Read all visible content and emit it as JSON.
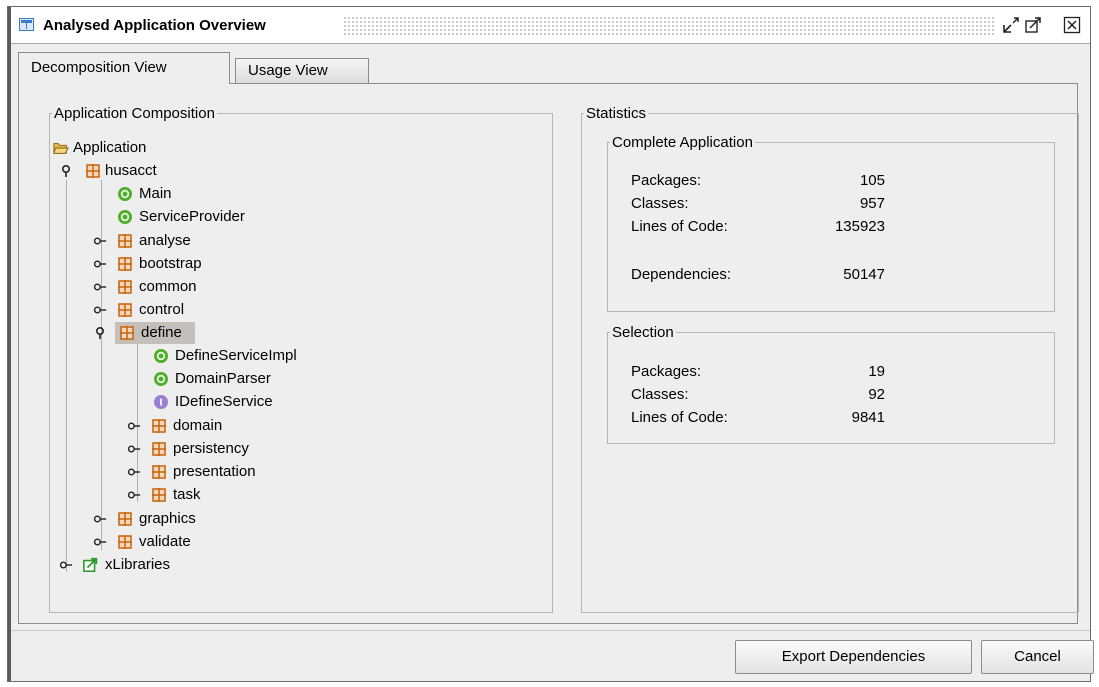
{
  "window": {
    "title": "Analysed Application Overview",
    "icons": [
      "window-icon",
      "minimize-icon",
      "maximize-icon",
      "close-icon"
    ]
  },
  "tabs": [
    {
      "label": "Decomposition View",
      "selected": true
    },
    {
      "label": "Usage View",
      "selected": false
    }
  ],
  "composition": {
    "legend": "Application Composition",
    "root": "Application",
    "nodes": {
      "husacct": "husacct",
      "main": "Main",
      "service_provider": "ServiceProvider",
      "analyse": "analyse",
      "bootstrap": "bootstrap",
      "common": "common",
      "control": "control",
      "define": "define",
      "define_service_impl": "DefineServiceImpl",
      "domain_parser": "DomainParser",
      "idefine_service": "IDefineService",
      "domain": "domain",
      "persistency": "persistency",
      "presentation": "presentation",
      "task": "task",
      "graphics": "graphics",
      "validate": "validate",
      "xlibraries": "xLibraries"
    },
    "selected_node": "define"
  },
  "statistics": {
    "legend": "Statistics",
    "complete": {
      "legend": "Complete Application",
      "packages_label": "Packages:",
      "packages": "105",
      "classes_label": "Classes:",
      "classes": "957",
      "loc_label": "Lines of Code:",
      "loc": "135923",
      "deps_label": "Dependencies:",
      "deps": "50147"
    },
    "selection": {
      "legend": "Selection",
      "packages_label": "Packages:",
      "packages": "19",
      "classes_label": "Classes:",
      "classes": "92",
      "loc_label": "Lines of Code:",
      "loc": "9841"
    }
  },
  "buttons": {
    "export": "Export Dependencies",
    "cancel": "Cancel"
  },
  "colors": {
    "package_icon": "#c8620a",
    "class_icon": "#4fae2c",
    "interface_icon": "#9b7fd1",
    "library_icon": "#2e9a2e",
    "selection_bg": "#c4bfb8"
  }
}
